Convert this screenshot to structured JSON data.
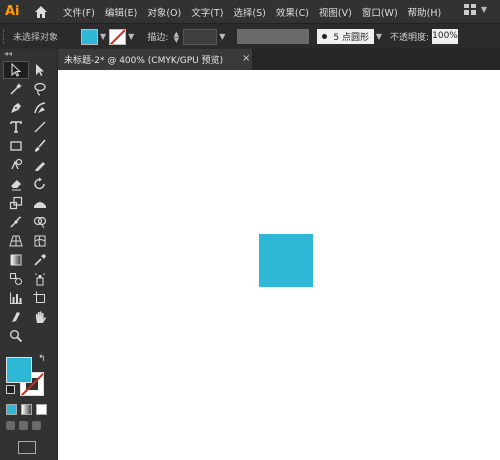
{
  "app": {
    "logo_text": "Ai"
  },
  "menu": [
    "文件(F)",
    "编辑(E)",
    "对象(O)",
    "文字(T)",
    "选择(S)",
    "效果(C)",
    "视图(V)",
    "窗口(W)",
    "帮助(H)"
  ],
  "control_bar": {
    "selection_label": "未选择对象",
    "fill_color": "#2fb8d6",
    "stroke_label": "描边:",
    "brush_label": "5 点圆形",
    "opacity_label": "不透明度:",
    "opacity_value": "100%"
  },
  "document_tab": {
    "title": "未标题-2* @ 400% (CMYK/GPU 预览)",
    "close": "×"
  },
  "tools": [
    "selection",
    "direct-selection",
    "magic-wand",
    "lasso",
    "pen",
    "curvature",
    "type",
    "line-segment",
    "rectangle",
    "paintbrush",
    "shaper",
    "pencil",
    "eraser",
    "rotate",
    "scale",
    "width",
    "puppet-warp",
    "shape-builder",
    "perspective-grid",
    "mesh",
    "gradient",
    "eyedropper",
    "blend",
    "symbol-sprayer",
    "column-graph",
    "artboard",
    "slice",
    "hand",
    "zoom"
  ],
  "canvas": {
    "shape_color": "#2fb8d6"
  }
}
